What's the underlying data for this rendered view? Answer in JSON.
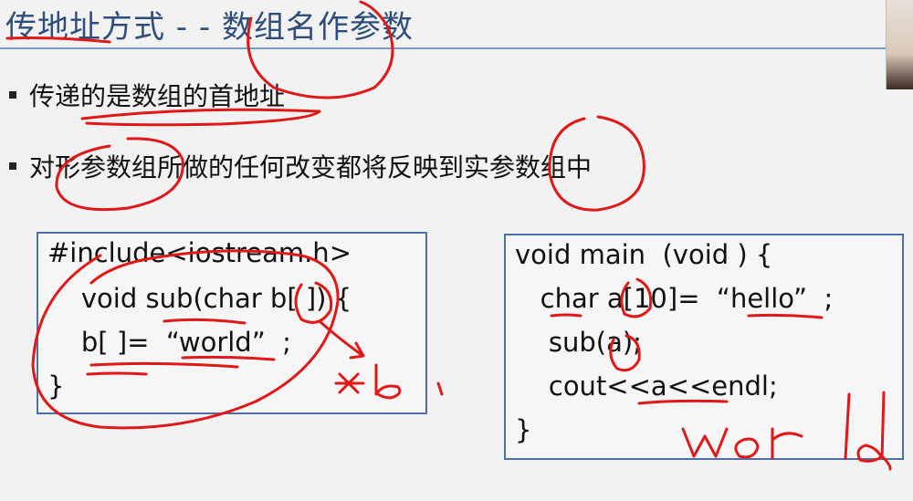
{
  "slide": {
    "title": "传地址方式 - - 数组名作参数",
    "bullets": [
      "传递的是数组的首地址",
      "对形参数组所做的任何改变都将反映到实参数组中"
    ]
  },
  "left_code": {
    "lines": [
      "#include<iostream.h>",
      "    void sub(char b[ ]) {",
      "    b[ ]=  “world”  ;",
      "}"
    ]
  },
  "right_code": {
    "lines": [
      "void main  (void ) {",
      "   char a[10]=  “hello”  ;",
      "    sub(a);",
      "    cout<<a<<endl;",
      "}"
    ]
  },
  "annotations": {
    "handwritten_star_b": "*b",
    "handwritten_world": "world"
  },
  "colors": {
    "title": "#2e4d7a",
    "rule": "#7f9bc3",
    "box_border": "#4f6fa8",
    "ink": "#e01818"
  }
}
